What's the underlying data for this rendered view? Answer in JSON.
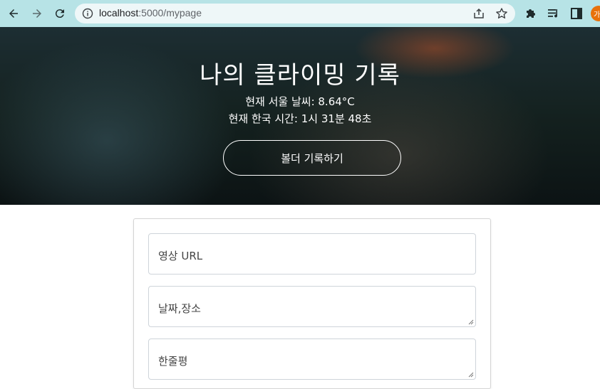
{
  "browser": {
    "url_host": "localhost",
    "url_rest": ":5000/mypage",
    "profile_initial": "가"
  },
  "hero": {
    "title": "나의 클라이밍 기록",
    "weather": "현재 서울 날씨: 8.64°C",
    "time": "현재 한국 시간: 1시 31분 48초",
    "button_label": "볼더 기록하기"
  },
  "form": {
    "video_url_placeholder": "영상 URL",
    "date_place_placeholder": "날짜,장소",
    "review_placeholder": "한줄평"
  },
  "colors": {
    "chrome_bg": "#b7e3e6",
    "profile_bg": "#e8710a"
  }
}
